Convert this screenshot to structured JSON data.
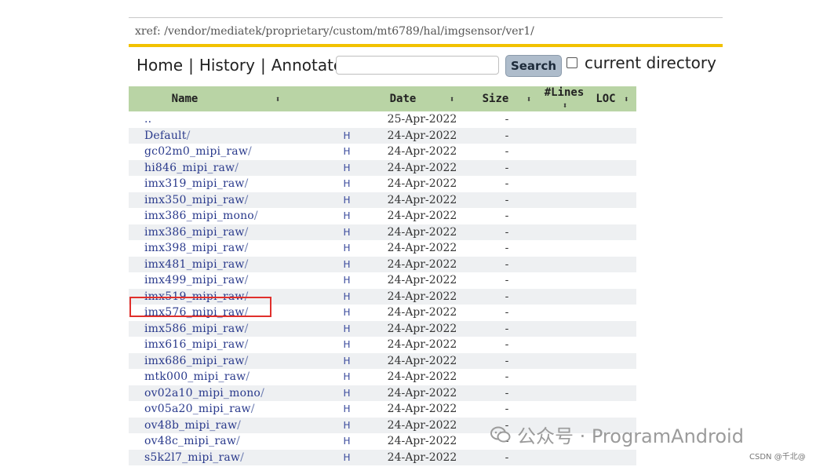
{
  "xref": {
    "path": "xref: /vendor/mediatek/proprietary/custom/mt6789/hal/imgsensor/ver1/"
  },
  "nav": {
    "home": "Home",
    "history": "History",
    "annotate": "Annotate",
    "search_button": "Search",
    "current_directory": "current directory",
    "search_value": "",
    "separator": "|"
  },
  "table": {
    "headers": {
      "name": "Name",
      "date": "Date",
      "size": "Size",
      "lines": "#Lines",
      "loc": "LOC"
    },
    "sort_icon": "⬍",
    "rows": [
      {
        "name": "..",
        "slash": "",
        "h": "",
        "date": "25-Apr-2022",
        "size": "-"
      },
      {
        "name": "Default",
        "slash": "/",
        "h": "H",
        "date": "24-Apr-2022",
        "size": "-"
      },
      {
        "name": "gc02m0_mipi_raw",
        "slash": "/",
        "h": "H",
        "date": "24-Apr-2022",
        "size": "-"
      },
      {
        "name": "hi846_mipi_raw",
        "slash": "/",
        "h": "H",
        "date": "24-Apr-2022",
        "size": "-"
      },
      {
        "name": "imx319_mipi_raw",
        "slash": "/",
        "h": "H",
        "date": "24-Apr-2022",
        "size": "-"
      },
      {
        "name": "imx350_mipi_raw",
        "slash": "/",
        "h": "H",
        "date": "24-Apr-2022",
        "size": "-"
      },
      {
        "name": "imx386_mipi_mono",
        "slash": "/",
        "h": "H",
        "date": "24-Apr-2022",
        "size": "-"
      },
      {
        "name": "imx386_mipi_raw",
        "slash": "/",
        "h": "H",
        "date": "24-Apr-2022",
        "size": "-"
      },
      {
        "name": "imx398_mipi_raw",
        "slash": "/",
        "h": "H",
        "date": "24-Apr-2022",
        "size": "-"
      },
      {
        "name": "imx481_mipi_raw",
        "slash": "/",
        "h": "H",
        "date": "24-Apr-2022",
        "size": "-"
      },
      {
        "name": "imx499_mipi_raw",
        "slash": "/",
        "h": "H",
        "date": "24-Apr-2022",
        "size": "-"
      },
      {
        "name": "imx519_mipi_raw",
        "slash": "/",
        "h": "H",
        "date": "24-Apr-2022",
        "size": "-"
      },
      {
        "name": "imx576_mipi_raw",
        "slash": "/",
        "h": "H",
        "date": "24-Apr-2022",
        "size": "-"
      },
      {
        "name": "imx586_mipi_raw",
        "slash": "/",
        "h": "H",
        "date": "24-Apr-2022",
        "size": "-"
      },
      {
        "name": "imx616_mipi_raw",
        "slash": "/",
        "h": "H",
        "date": "24-Apr-2022",
        "size": "-"
      },
      {
        "name": "imx686_mipi_raw",
        "slash": "/",
        "h": "H",
        "date": "24-Apr-2022",
        "size": "-"
      },
      {
        "name": "mtk000_mipi_raw",
        "slash": "/",
        "h": "H",
        "date": "24-Apr-2022",
        "size": "-"
      },
      {
        "name": "ov02a10_mipi_mono",
        "slash": "/",
        "h": "H",
        "date": "24-Apr-2022",
        "size": "-"
      },
      {
        "name": "ov05a20_mipi_raw",
        "slash": "/",
        "h": "H",
        "date": "24-Apr-2022",
        "size": "-"
      },
      {
        "name": "ov48b_mipi_raw",
        "slash": "/",
        "h": "H",
        "date": "24-Apr-2022",
        "size": "-"
      },
      {
        "name": "ov48c_mipi_raw",
        "slash": "/",
        "h": "H",
        "date": "24-Apr-2022",
        "size": "-"
      },
      {
        "name": "s5k2l7_mipi_raw",
        "slash": "/",
        "h": "H",
        "date": "24-Apr-2022",
        "size": "-"
      }
    ]
  },
  "watermark": {
    "text": "公众号 · ProgramAndroid"
  },
  "credit": {
    "text": "CSDN @千北@"
  },
  "colors": {
    "accent_bar": "#f2c200",
    "header_bg": "#b9d4a5",
    "link": "#2a3a8c",
    "highlight": "#e0302c"
  }
}
